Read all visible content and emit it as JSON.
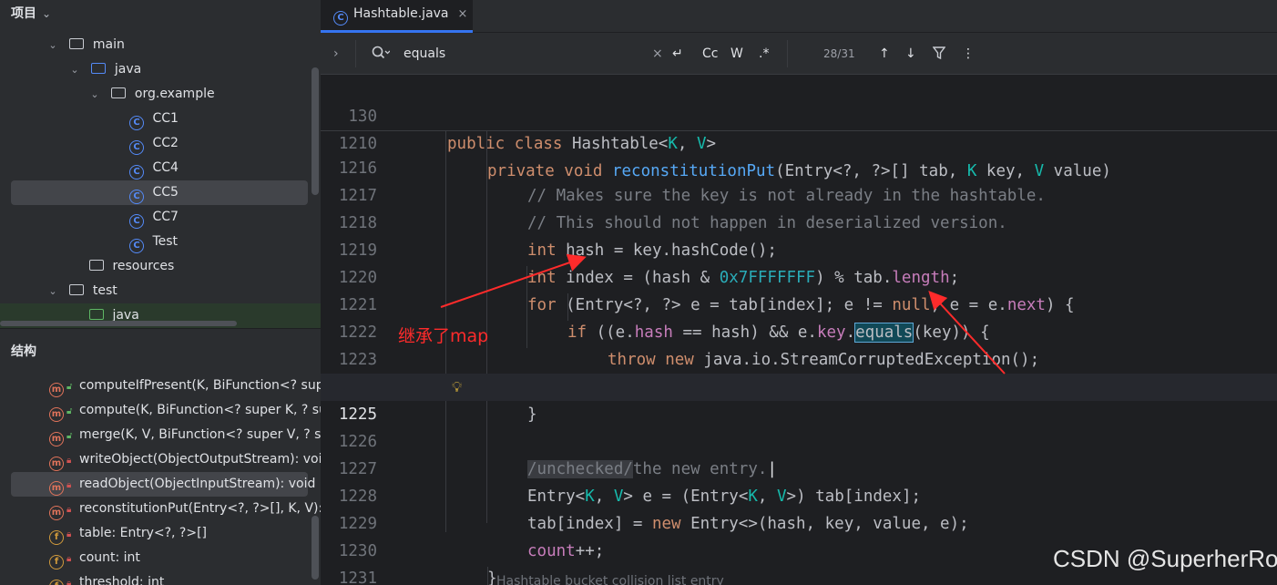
{
  "project": {
    "title": "项目",
    "items": [
      {
        "label": "main",
        "arrow": "⌄",
        "icon": "folder"
      },
      {
        "label": "java",
        "arrow": "⌄",
        "icon": "folder-source"
      },
      {
        "label": "org.example",
        "arrow": "⌄",
        "icon": "package"
      },
      {
        "label": "CC1",
        "icon": "class"
      },
      {
        "label": "CC2",
        "icon": "class"
      },
      {
        "label": "CC4",
        "icon": "class"
      },
      {
        "label": "CC5",
        "icon": "class",
        "selected": true
      },
      {
        "label": "CC7",
        "icon": "class"
      },
      {
        "label": "Test",
        "icon": "class"
      },
      {
        "label": "resources",
        "icon": "folder-resources"
      },
      {
        "label": "test",
        "arrow": "⌄",
        "icon": "folder"
      },
      {
        "label": "java",
        "icon": "folder-test"
      }
    ]
  },
  "structure": {
    "title": "结构",
    "items": [
      {
        "label": "computeIfPresent(K, BiFunction<? super",
        "kind": "m",
        "vis": "public"
      },
      {
        "label": "compute(K, BiFunction<? super K, ? sup",
        "kind": "m",
        "vis": "public"
      },
      {
        "label": "merge(K, V, BiFunction<? super V, ? sup",
        "kind": "m",
        "vis": "public"
      },
      {
        "label": "writeObject(ObjectOutputStream): void",
        "kind": "m",
        "vis": "private"
      },
      {
        "label": "readObject(ObjectInputStream): void",
        "kind": "m",
        "vis": "private",
        "selected": true
      },
      {
        "label": "reconstitutionPut(Entry<?, ?>[], K, V): vo",
        "kind": "m",
        "vis": "private"
      },
      {
        "label": "table: Entry<?, ?>[]",
        "kind": "f",
        "vis": "private"
      },
      {
        "label": "count: int",
        "kind": "f",
        "vis": "private"
      },
      {
        "label": "threshold: int",
        "kind": "f",
        "vis": "private"
      }
    ]
  },
  "editor": {
    "tab_label": "Hashtable.java",
    "tab_close": "×",
    "find": {
      "query": "equals",
      "clear": "×",
      "regex_opts": [
        "Cc",
        "W",
        ".*"
      ],
      "match_count": "28/31"
    }
  },
  "annotation": "继承了map",
  "hint": "Hashtable bucket collision list entry",
  "watermark": "CSDN @SuperherRo",
  "colors": {
    "accent": "#3574f0",
    "annotation": "#ff2b2b",
    "keyword": "#cf8e6d",
    "function": "#56a8f5"
  }
}
